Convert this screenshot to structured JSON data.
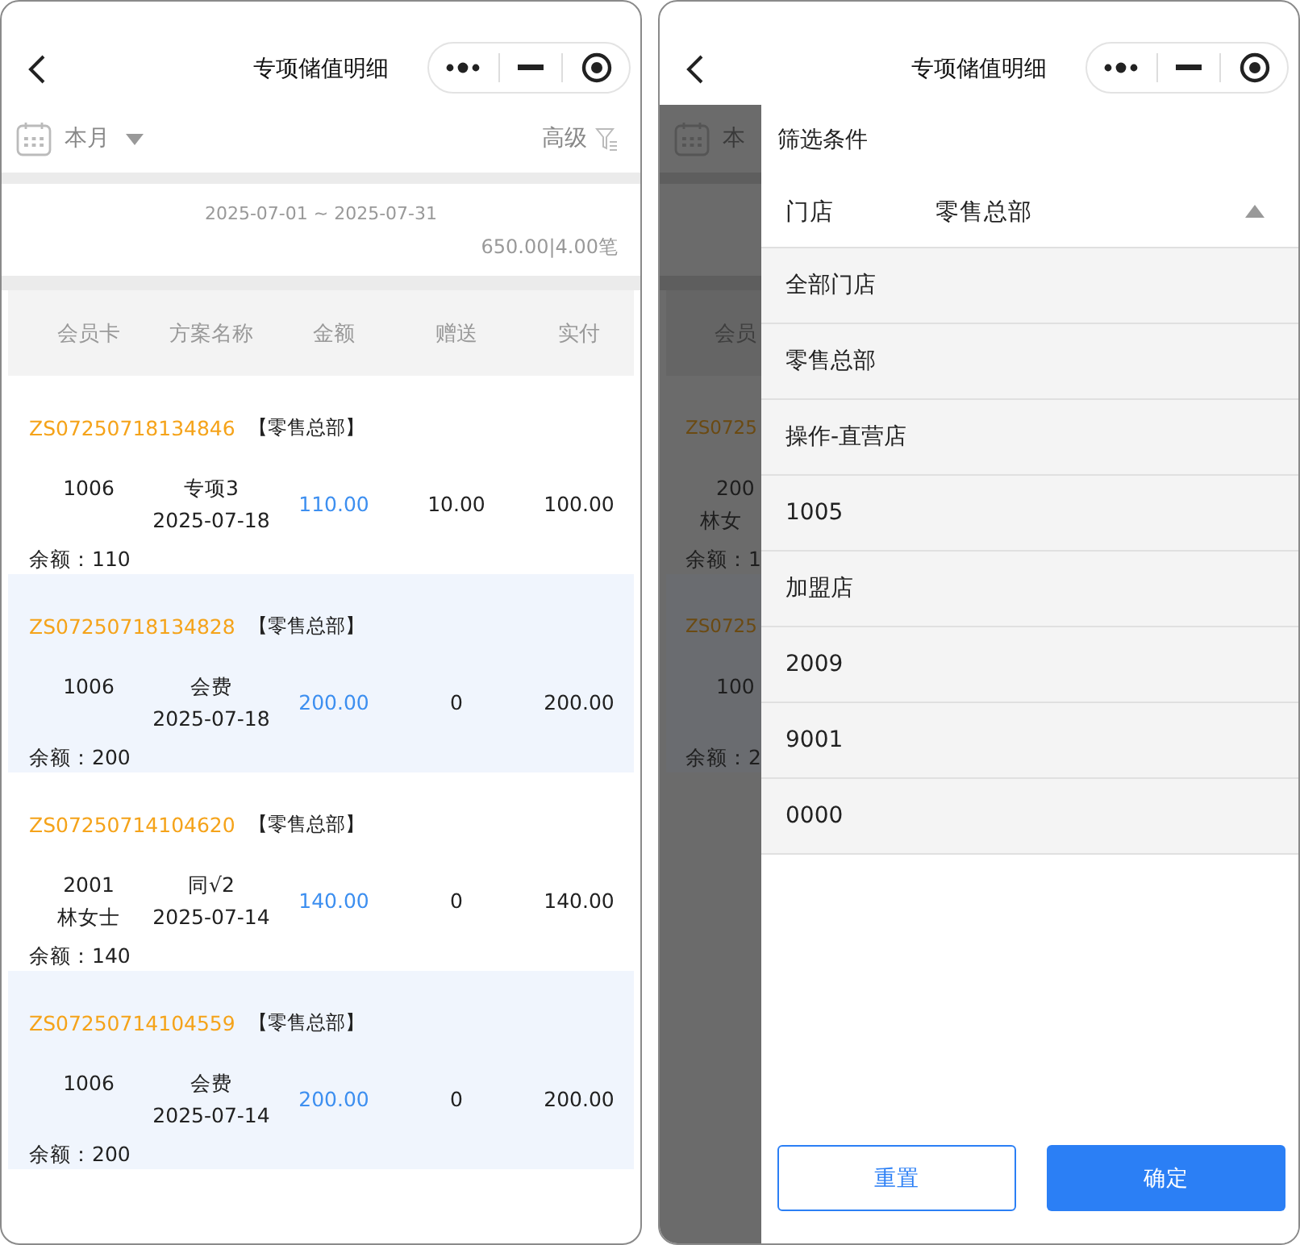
{
  "list_screen": {
    "nav": {
      "title": "专项储值明细"
    },
    "period": {
      "label": "本月"
    },
    "advanced": {
      "label": "高级"
    },
    "summary": {
      "range": "2025-07-01 ~ 2025-07-31",
      "total": "650.00|4.00笔"
    },
    "columns": [
      "会员卡",
      "方案名称",
      "金额",
      "赠送",
      "实付"
    ],
    "rows": [
      {
        "order_no": "ZS07250718134846",
        "store": "【零售总部】",
        "card": "1006",
        "plan": "专项3",
        "date": "2025-07-18",
        "amount": "110.00",
        "bonus": "10.00",
        "paid": "100.00",
        "balance": "余额：110"
      },
      {
        "order_no": "ZS07250718134828",
        "store": "【零售总部】",
        "card": "1006",
        "plan": "会费",
        "date": "2025-07-18",
        "amount": "200.00",
        "bonus": "0",
        "paid": "200.00",
        "balance": "余额：200"
      },
      {
        "order_no": "ZS07250714104620",
        "store": "【零售总部】",
        "card": "2001",
        "member": "林女士",
        "plan": "同√2",
        "date": "2025-07-14",
        "amount": "140.00",
        "bonus": "0",
        "paid": "140.00",
        "balance": "余额：140"
      },
      {
        "order_no": "ZS07250714104559",
        "store": "【零售总部】",
        "card": "1006",
        "plan": "会费",
        "date": "2025-07-14",
        "amount": "200.00",
        "bonus": "0",
        "paid": "200.00",
        "balance": "余额：200"
      }
    ]
  },
  "filter_screen": {
    "nav": {
      "title": "专项储值明细"
    },
    "background": {
      "period": "本",
      "column": "会员",
      "rows": [
        {
          "order_no": "ZS0725",
          "card": "200",
          "member": "林女",
          "balance": "余额：1"
        },
        {
          "order_no": "ZS0725",
          "card": "100",
          "balance": "余额：2"
        }
      ]
    },
    "drawer": {
      "title": "筛选条件",
      "store_label": "门店",
      "store_value": "零售总部",
      "expanded": true,
      "options": [
        {
          "label": "全部门店",
          "selected": false
        },
        {
          "label": "零售总部",
          "selected": false
        },
        {
          "label": "操作-直营店",
          "selected": false
        },
        {
          "label": "1005",
          "selected": false
        },
        {
          "label": "加盟店",
          "selected": false
        },
        {
          "label": "2009",
          "selected": false
        },
        {
          "label": "9001",
          "selected": false
        },
        {
          "label": "0000",
          "selected": false
        }
      ],
      "reset": "重置",
      "confirm": "确定"
    }
  }
}
